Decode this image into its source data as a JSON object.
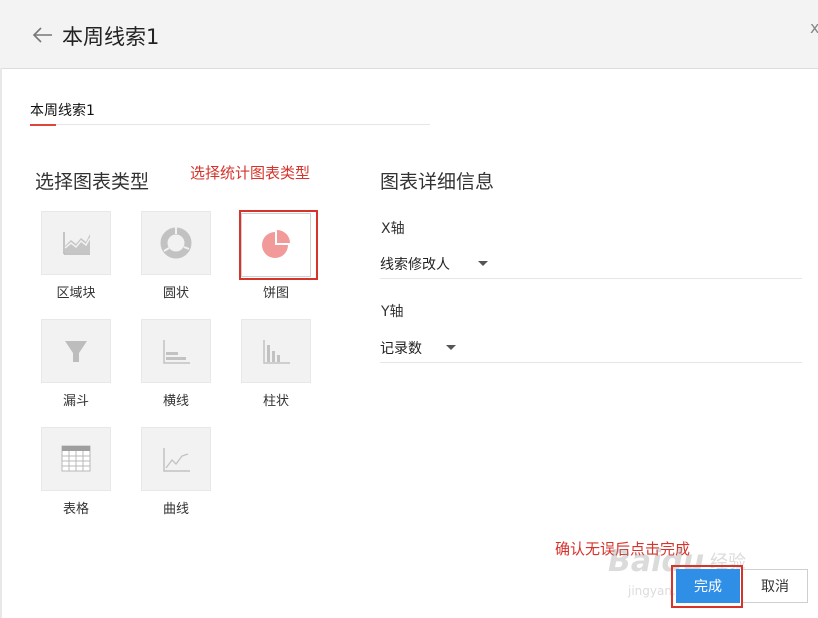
{
  "header": {
    "title": "本周线索1",
    "close_glyph": "x"
  },
  "name_field": {
    "value": "本周线索1"
  },
  "chart_type_section": {
    "title": "选择图表类型",
    "annotation": "选择统计图表类型",
    "options": [
      {
        "id": "area",
        "label": "区域块",
        "icon": "area-chart-icon"
      },
      {
        "id": "donut",
        "label": "圆状",
        "icon": "donut-chart-icon"
      },
      {
        "id": "pie",
        "label": "饼图",
        "icon": "pie-chart-icon",
        "selected": true
      },
      {
        "id": "funnel",
        "label": "漏斗",
        "icon": "funnel-chart-icon"
      },
      {
        "id": "hbar",
        "label": "横线",
        "icon": "horizontal-bar-chart-icon"
      },
      {
        "id": "vbar",
        "label": "柱状",
        "icon": "column-chart-icon"
      },
      {
        "id": "table",
        "label": "表格",
        "icon": "table-icon"
      },
      {
        "id": "line",
        "label": "曲线",
        "icon": "line-chart-icon"
      }
    ]
  },
  "details_section": {
    "title": "图表详细信息",
    "x_axis": {
      "label": "X轴",
      "value": "线索修改人"
    },
    "y_axis": {
      "label": "Y轴",
      "value": "记录数"
    }
  },
  "footer": {
    "annotation": "确认无误后点击完成",
    "done_label": "完成",
    "cancel_label": "取消"
  },
  "watermark": {
    "text1": "Baidu",
    "text2": "经验",
    "text3": "jingyan.baidu.com"
  },
  "colors": {
    "accent_blue": "#2f8ee6",
    "annotation_red": "#d6332b",
    "pie_pink": "#f29a9a"
  }
}
